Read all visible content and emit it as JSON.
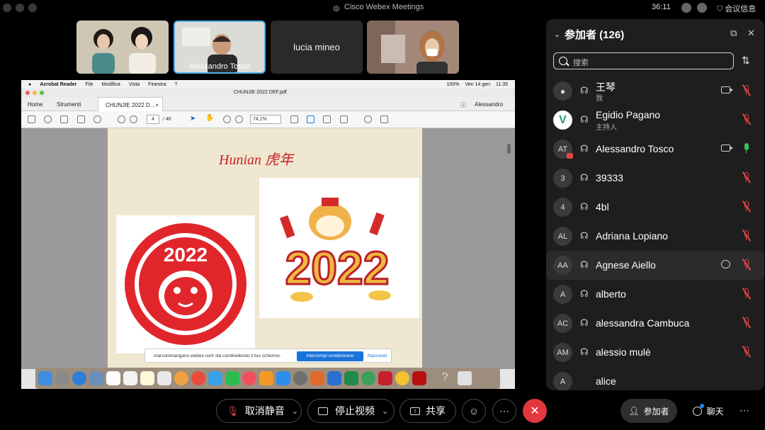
{
  "titlebar": {
    "app_title": "Cisco Webex Meetings",
    "timer": "36:11",
    "meeting_info": "会议信息"
  },
  "videos": [
    {
      "name": ""
    },
    {
      "name": "Alessandro Tosco"
    },
    {
      "name": "lucia mineo"
    },
    {
      "name": ""
    }
  ],
  "shared": {
    "mac_menu": [
      "Acrobat Reader",
      "File",
      "Modifica",
      "Vista",
      "Finestra",
      "?"
    ],
    "mac_status": [
      "100%",
      "Ven 14 gen",
      "11:35"
    ],
    "doc_title": "CHUNJIE 2022 DEF.pdf",
    "tabs": {
      "home": "Home",
      "tools": "Strumenti",
      "doc": "CHUNJIE 2022 D...",
      "user": "Alessandro"
    },
    "page_current": "4",
    "page_total": "/ 46",
    "zoom": "74,1%",
    "slide_title": "Hunian 虎年",
    "share_message": "marconimangano.webex.com sta condividendo il tuo schermo.",
    "stop_share": "Interrompi condivisione",
    "hide": "Nascondi"
  },
  "panel": {
    "title": "参加者 (126)",
    "search_placeholder": "搜索",
    "participants": [
      {
        "initials": "",
        "name": "王琴",
        "sub": "我",
        "mic": "muted",
        "cam": true,
        "chat": false
      },
      {
        "initials": "",
        "name": "Egidio Pagano",
        "sub": "主持人",
        "mic": "muted",
        "cam": false,
        "chat": false
      },
      {
        "initials": "AT",
        "name": "Alessandro Tosco",
        "sub": "",
        "mic": "on",
        "cam": true,
        "chat": false
      },
      {
        "initials": "3",
        "name": "39333",
        "sub": "",
        "mic": "muted",
        "cam": false,
        "chat": false
      },
      {
        "initials": "4",
        "name": "4bl",
        "sub": "",
        "mic": "muted",
        "cam": false,
        "chat": false
      },
      {
        "initials": "AL",
        "name": "Adriana Lopiano",
        "sub": "",
        "mic": "muted",
        "cam": false,
        "chat": false
      },
      {
        "initials": "AA",
        "name": "Agnese Aiello",
        "sub": "",
        "mic": "muted",
        "cam": false,
        "chat": true
      },
      {
        "initials": "A",
        "name": "alberto",
        "sub": "",
        "mic": "muted",
        "cam": false,
        "chat": false
      },
      {
        "initials": "AC",
        "name": "alessandra Cambuca",
        "sub": "",
        "mic": "muted",
        "cam": false,
        "chat": false
      },
      {
        "initials": "AM",
        "name": "alessio mulè",
        "sub": "",
        "mic": "muted",
        "cam": false,
        "chat": false
      },
      {
        "initials": "A",
        "name": "alice",
        "sub": "",
        "mic": "",
        "cam": false,
        "chat": false
      }
    ]
  },
  "bottombar": {
    "unmute": "取消静音",
    "stop_video": "停止视频",
    "share": "共享",
    "participants": "参加者",
    "chat": "聊天"
  },
  "colors": {
    "accent": "#53b0e6",
    "end_call": "#e0383e",
    "muted": "#e0464b",
    "mic_on": "#3cbf5e"
  }
}
